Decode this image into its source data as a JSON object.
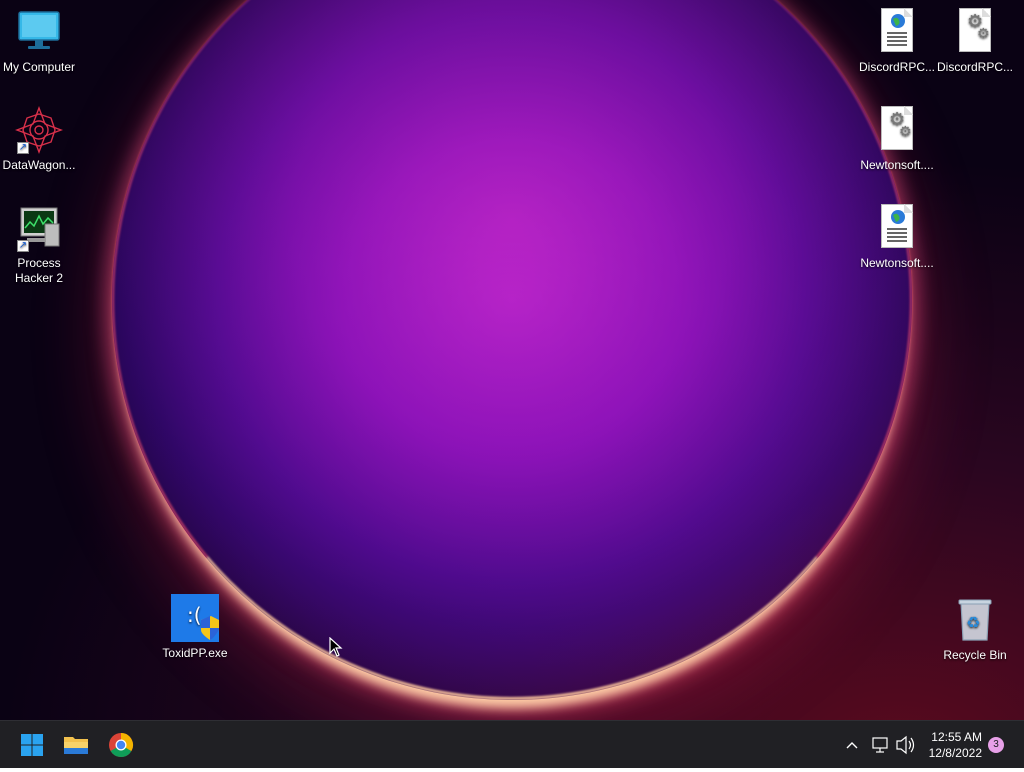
{
  "desktop": {
    "icons": [
      {
        "label": "My Computer",
        "kind": "computer-icon"
      },
      {
        "label": "DataWagon...",
        "kind": "datawagon-icon",
        "shortcut": true
      },
      {
        "label": "Process Hacker 2",
        "kind": "process-hacker-icon",
        "shortcut": true
      },
      {
        "label": "ToxidPP.exe",
        "kind": "exe-shield-icon"
      },
      {
        "label": "DiscordRPC...",
        "kind": "web-document-icon"
      },
      {
        "label": "DiscordRPC...",
        "kind": "config-document-icon"
      },
      {
        "label": "Newtonsoft....",
        "kind": "config-document-icon"
      },
      {
        "label": "Newtonsoft....",
        "kind": "web-document-icon"
      },
      {
        "label": "Recycle Bin",
        "kind": "recycle-bin-icon"
      }
    ]
  },
  "taskbar": {
    "pinned": [
      {
        "name": "start-button",
        "icon": "windows-logo-icon"
      },
      {
        "name": "file-explorer-button",
        "icon": "folder-icon"
      },
      {
        "name": "chrome-button",
        "icon": "chrome-icon"
      }
    ],
    "tray": {
      "chevron": "chevron-up-icon",
      "network": "network-icon",
      "volume": "speaker-icon"
    },
    "clock": {
      "time": "12:55 AM",
      "date": "12/8/2022"
    },
    "notifications": {
      "count": "3"
    }
  },
  "colors": {
    "taskbar_bg": "#202024",
    "windows_blue": "#2aa3f0",
    "folder_yellow": "#f2c14e"
  }
}
